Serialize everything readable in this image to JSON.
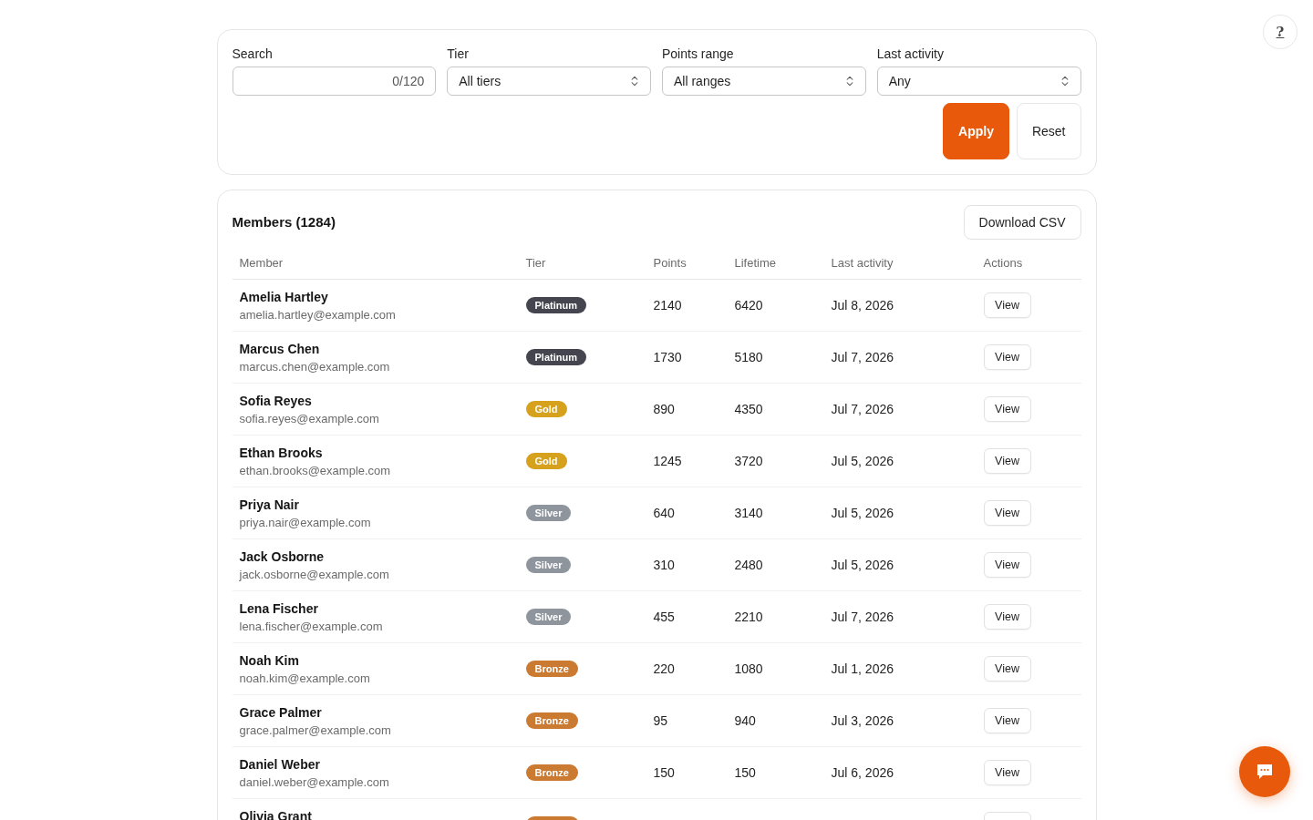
{
  "help_button": {
    "label": "?"
  },
  "filters": {
    "fields": [
      {
        "kind": "text",
        "label": "Search",
        "counter": "0/120"
      },
      {
        "kind": "select",
        "label": "Tier",
        "value": "All tiers"
      },
      {
        "kind": "select",
        "label": "Points range",
        "value": "All ranges"
      },
      {
        "kind": "select",
        "label": "Last activity",
        "value": "Any"
      }
    ],
    "buttons": [
      {
        "kind": "primary",
        "label": "Apply"
      },
      {
        "kind": "secondary",
        "label": "Reset"
      }
    ]
  },
  "members": {
    "title": "Members (1284)",
    "download_button": "Download CSV",
    "columns": [
      "Member",
      "Tier",
      "Points",
      "Lifetime",
      "Last activity",
      "Actions"
    ],
    "rows": [
      {
        "name": "Amelia Hartley",
        "email": "amelia.hartley@example.com",
        "tier": {
          "label": "Platinum",
          "color": "#45454f"
        },
        "points": "2140",
        "lifetime": "6420",
        "last_activity": "Jul 8, 2026",
        "action": "View"
      },
      {
        "name": "Marcus Chen",
        "email": "marcus.chen@example.com",
        "tier": {
          "label": "Platinum",
          "color": "#45454f"
        },
        "points": "1730",
        "lifetime": "5180",
        "last_activity": "Jul 7, 2026",
        "action": "View"
      },
      {
        "name": "Sofia Reyes",
        "email": "sofia.reyes@example.com",
        "tier": {
          "label": "Gold",
          "color": "#d6a21e"
        },
        "points": "890",
        "lifetime": "4350",
        "last_activity": "Jul 7, 2026",
        "action": "View"
      },
      {
        "name": "Ethan Brooks",
        "email": "ethan.brooks@example.com",
        "tier": {
          "label": "Gold",
          "color": "#d6a21e"
        },
        "points": "1245",
        "lifetime": "3720",
        "last_activity": "Jul 5, 2026",
        "action": "View"
      },
      {
        "name": "Priya Nair",
        "email": "priya.nair@example.com",
        "tier": {
          "label": "Silver",
          "color": "#8f959d"
        },
        "points": "640",
        "lifetime": "3140",
        "last_activity": "Jul 5, 2026",
        "action": "View"
      },
      {
        "name": "Jack Osborne",
        "email": "jack.osborne@example.com",
        "tier": {
          "label": "Silver",
          "color": "#8f959d"
        },
        "points": "310",
        "lifetime": "2480",
        "last_activity": "Jul 5, 2026",
        "action": "View"
      },
      {
        "name": "Lena Fischer",
        "email": "lena.fischer@example.com",
        "tier": {
          "label": "Silver",
          "color": "#8f959d"
        },
        "points": "455",
        "lifetime": "2210",
        "last_activity": "Jul 7, 2026",
        "action": "View"
      },
      {
        "name": "Noah Kim",
        "email": "noah.kim@example.com",
        "tier": {
          "label": "Bronze",
          "color": "#cb7a32"
        },
        "points": "220",
        "lifetime": "1080",
        "last_activity": "Jul 1, 2026",
        "action": "View"
      },
      {
        "name": "Grace Palmer",
        "email": "grace.palmer@example.com",
        "tier": {
          "label": "Bronze",
          "color": "#cb7a32"
        },
        "points": "95",
        "lifetime": "940",
        "last_activity": "Jul 3, 2026",
        "action": "View"
      },
      {
        "name": "Daniel Weber",
        "email": "daniel.weber@example.com",
        "tier": {
          "label": "Bronze",
          "color": "#cb7a32"
        },
        "points": "150",
        "lifetime": "150",
        "last_activity": "Jul 6, 2026",
        "action": "View"
      },
      {
        "name": "Olivia Grant",
        "tier": {
          "color": "#cb7a32"
        }
      }
    ]
  }
}
